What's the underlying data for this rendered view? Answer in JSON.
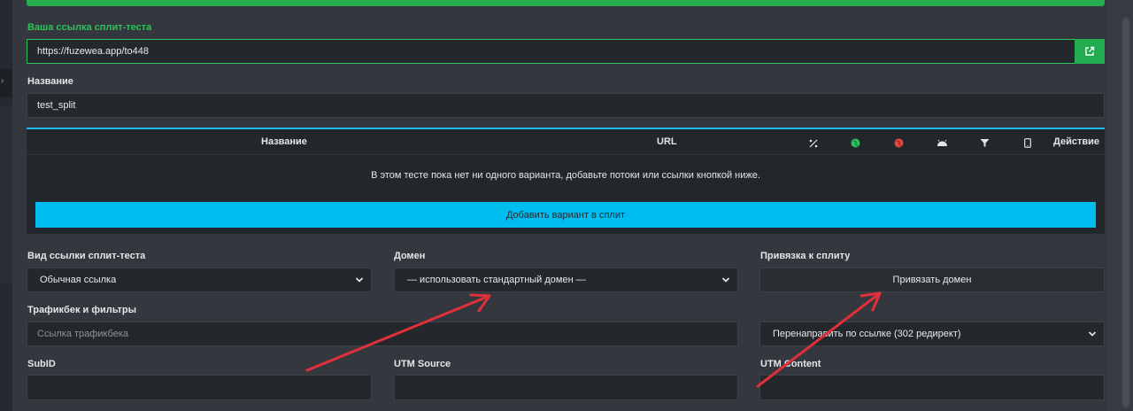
{
  "split_link": {
    "label": "Ваша ссылка сплит-теста",
    "value": "https://fuzewea.app/to448"
  },
  "name": {
    "label": "Название",
    "value": "test_split"
  },
  "variants_table": {
    "headers": {
      "name": "Название",
      "url": "URL",
      "percent_icon": "percent-icon",
      "allowed_geo_icon": "globe-green-icon",
      "blocked_geo_icon": "globe-red-icon",
      "os_icon": "android-icon",
      "filter_icon": "filter-icon",
      "device_icon": "mobile-icon",
      "action": "Действие"
    },
    "empty_message": "В этом тесте пока нет ни одного варианта, добавьте потоки или ссылки кнопкой ниже.",
    "add_button": "Добавить вариант в сплит"
  },
  "link_type": {
    "label": "Вид ссылки сплит-теста",
    "selected": "Обычная ссылка"
  },
  "domain": {
    "label": "Домен",
    "selected": "— использовать стандартный домен —"
  },
  "binding": {
    "label": "Привязка к сплиту",
    "button": "Привязать домен"
  },
  "trafficback": {
    "label": "Трафикбек и фильтры",
    "placeholder": "Ссылка трафикбека",
    "redirect_selected": "Перенаправить по ссылке (302 редирект)"
  },
  "subid": {
    "label": "SubID",
    "value": ""
  },
  "utm_source": {
    "label": "UTM Source",
    "value": ""
  },
  "utm_content": {
    "label": "UTM Content",
    "value": ""
  },
  "colors": {
    "accent_green": "#21ad4f",
    "accent_blue": "#00bdef",
    "annotation_red": "#e0303a"
  }
}
